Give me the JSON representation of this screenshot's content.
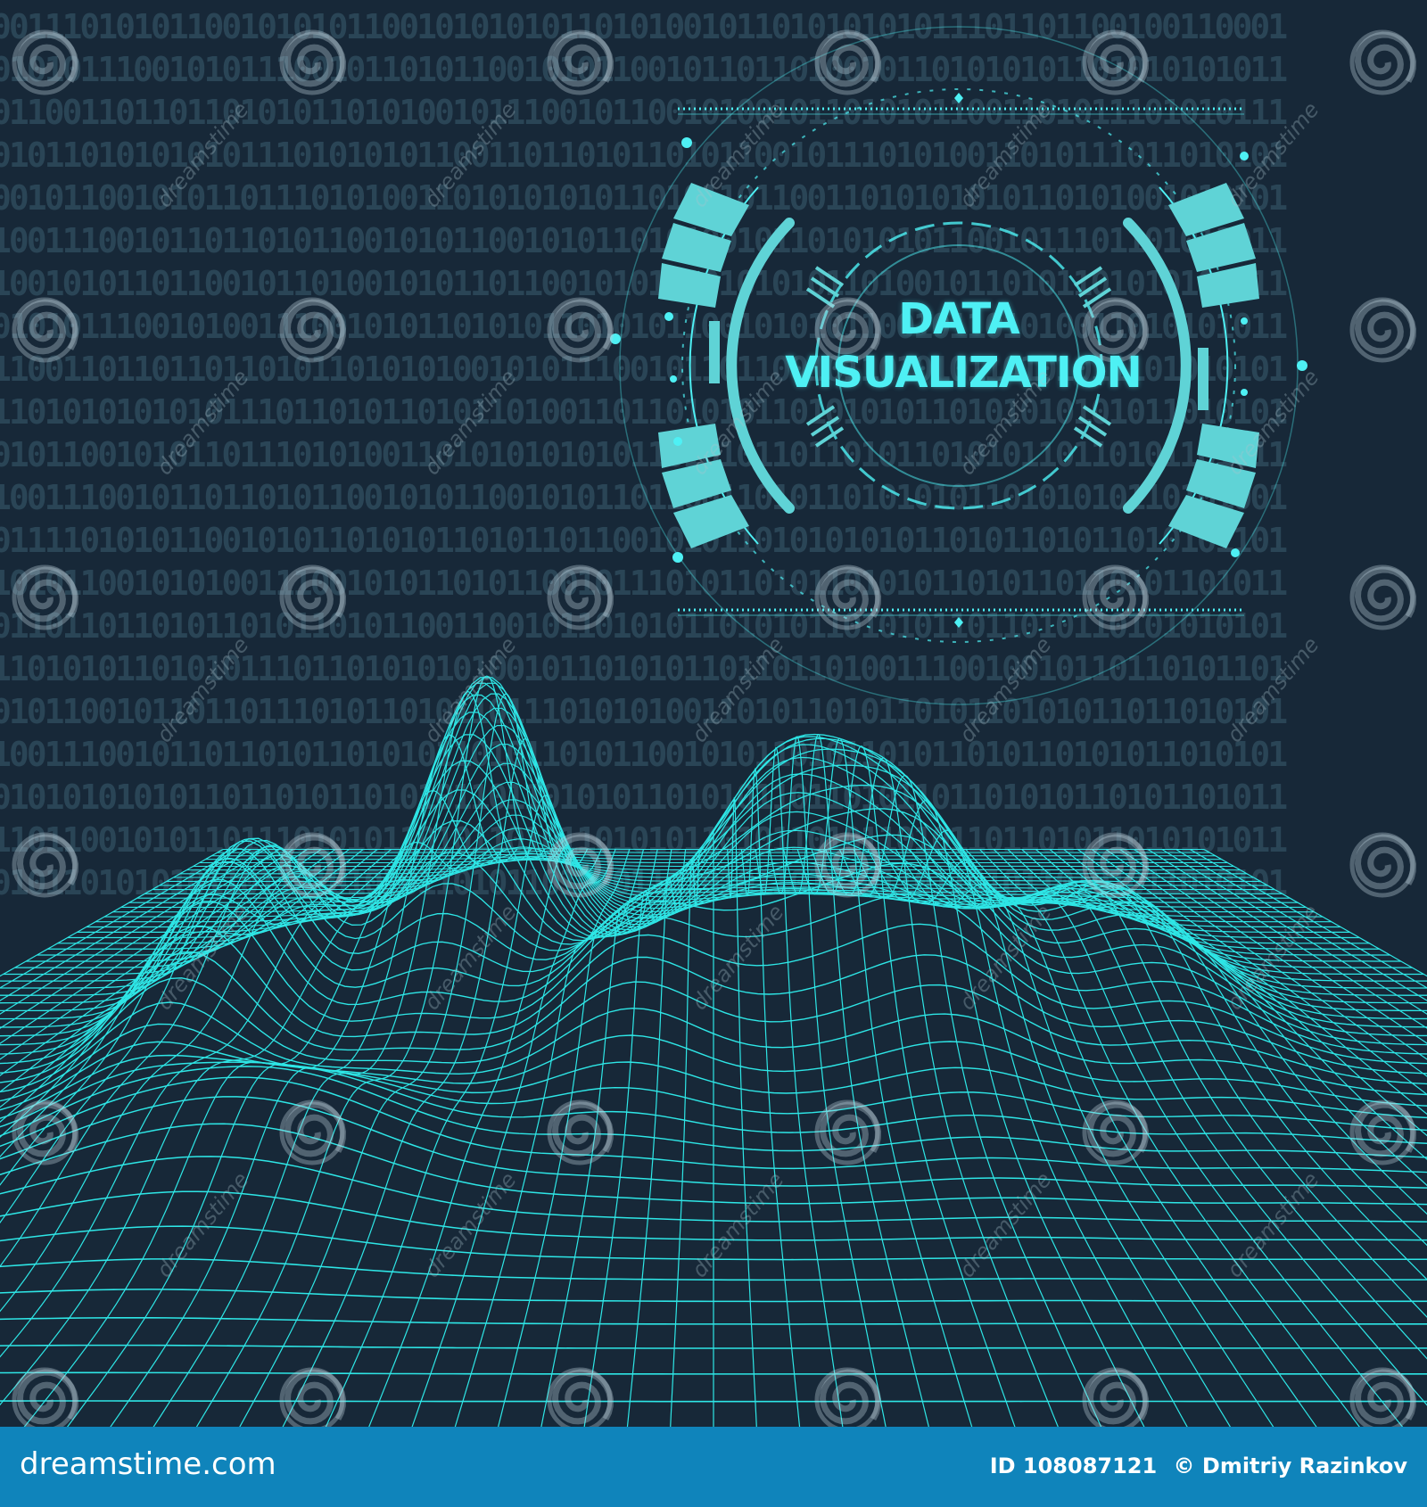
{
  "hud": {
    "title_line1": "DATA",
    "title_line2": "VISUALIZATION"
  },
  "background": {
    "binary_rows": [
      "0011101010110010101011001010101011010100101101010101011101101100100110001",
      "0101011100101011100101101011001010110010110110100101101010101101010101011",
      "0110011011011010101101010010111001011001010010110101011001101011101010111",
      "0101101010101011101010101100110110101101011001011101010011010111011010101",
      "0010110010101101110101001101010101011010110110011010101010110101001010101",
      "1001110010110110101100101011001010110101001011010101011001011101101011011",
      "1001010110110010110100101011011001010110010101011010010110101101010101011",
      "0101011100101001110010101101010110101011001010101100101101010011010101011",
      "1100110110110110101101010100101011100101101100101101010110101011101010101",
      "1101010101010111011010110101101001101101010110101010110101010101011010101",
      "0101100101011011101010011010101010101101010110110101101010110110101101011",
      "1001110010110110101100101011001010110110011010110101010110101010110101001",
      "0111101010110010101101010110101101100101011010101010110101101011010101101",
      "1010110010101001110010101101011001011101011010110101011010110110101101011",
      "0110110110101101011010110011001011010101101010110101011011010110101010101",
      "1101010110101011101101010101001011010101101101101001110010010110110101101",
      "0101100101101101110101101011011101010100110101101011010110101011011010101",
      "1001110010110110101101010110101101011001010110101101011010110101011010101",
      "0101010101011011010110101011011010101101010110110101101101010110101101011",
      "1101100101011011101010110101101011010101101011010110101101101011010101011",
      "0101101010101101101010101101011010101101010110101011011010110101011010101"
    ]
  },
  "watermark": {
    "text": "dreamstime"
  },
  "footer": {
    "logo_text": "dreamstime.com",
    "image_id": "ID 108087121",
    "author": "© Dmitriy Razinkov"
  },
  "colors": {
    "background": "#172838",
    "binary_digits": "#2a4556",
    "wireframe": "#2ee6e6",
    "hud_accent": "#4ef0f4",
    "hud_panel": "#5fd3d6",
    "footer_bar": "#0f84bb"
  },
  "icons": {
    "watermark_spiral": "spiral-watermark-icon"
  }
}
